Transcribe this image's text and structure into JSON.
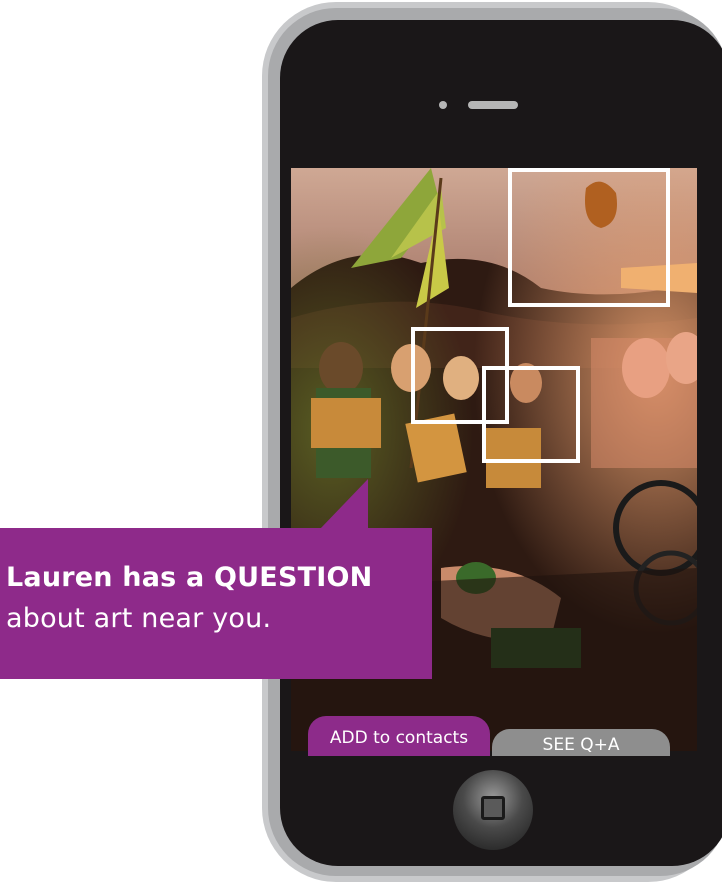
{
  "notification": {
    "headline": "Lauren has a QUESTION",
    "subline": "about art near you."
  },
  "tabs": {
    "add_label": "ADD to contacts",
    "see_label": "SEE Q+A"
  },
  "colors": {
    "accent_purple": "#8e2a8a",
    "tab_inactive": "#8e8e8e",
    "phone_body": "#1a1718",
    "phone_frame": "#a9aaac"
  }
}
